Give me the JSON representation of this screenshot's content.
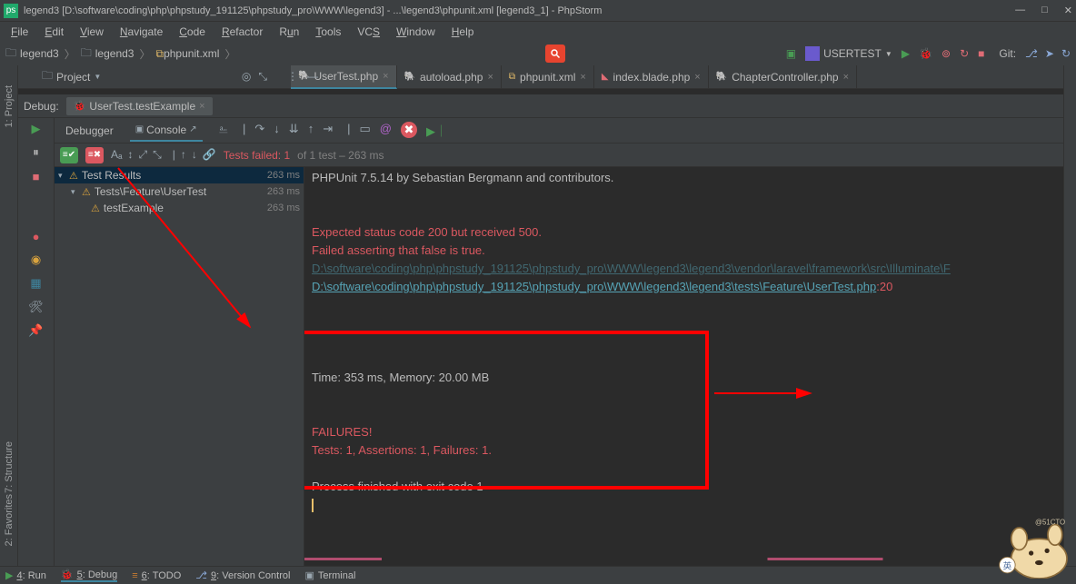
{
  "titlebar": {
    "text": "legend3 [D:\\software\\coding\\php\\phpstudy_191125\\phpstudy_pro\\WWW\\legend3] - ...\\legend3\\phpunit.xml [legend3_1] - PhpStorm"
  },
  "menu": [
    "File",
    "Edit",
    "View",
    "Navigate",
    "Code",
    "Refactor",
    "Run",
    "Tools",
    "VCS",
    "Window",
    "Help"
  ],
  "run_config": "USERTEST",
  "git_label": "Git:",
  "breadcrumb": {
    "project": "legend3",
    "folder": "legend3",
    "file": "phpunit.xml"
  },
  "project_panel": {
    "label": "Project"
  },
  "left_gutter": {
    "project": "1: Project",
    "structure": "7: Structure",
    "favorites": "2: Favorites"
  },
  "tabs": [
    {
      "label": "UserTest.php",
      "icon": "php",
      "active": true
    },
    {
      "label": "autoload.php",
      "icon": "php",
      "active": false
    },
    {
      "label": "phpunit.xml",
      "icon": "xml",
      "active": false
    },
    {
      "label": "index.blade.php",
      "icon": "blade",
      "active": false
    },
    {
      "label": "ChapterController.php",
      "icon": "php",
      "active": false
    }
  ],
  "debug_header": {
    "label": "Debug:",
    "tab": "UserTest.testExample"
  },
  "debugger_tabs": {
    "debugger": "Debugger",
    "console": "Console"
  },
  "results": {
    "failed_label": "Tests failed: 1",
    "of_label": " of 1 test – 263 ms"
  },
  "tree": [
    {
      "indent": 0,
      "name": "Test Results",
      "time": "263 ms",
      "selected": true,
      "chev": true
    },
    {
      "indent": 1,
      "name": "Tests\\Feature\\UserTest",
      "time": "263 ms",
      "selected": false,
      "chev": true
    },
    {
      "indent": 2,
      "name": "testExample",
      "time": "263 ms",
      "selected": false,
      "chev": false
    }
  ],
  "console": {
    "l1": "PHPUnit 7.5.14 by Sebastian Bergmann and contributors.",
    "l3": "Expected status code 200 but received 500.",
    "l4": "Failed asserting that false is true.",
    "l5": "D:\\software\\coding\\php\\phpstudy_191125\\phpstudy_pro\\WWW\\legend3\\legend3\\vendor\\laravel\\framework\\src\\Illuminate\\F",
    "l6a": "D:\\software\\coding\\php\\phpstudy_191125\\phpstudy_pro\\WWW\\legend3\\legend3\\tests\\Feature\\UserTest.php",
    "l6b": ":",
    "l6c": "20",
    "l8": "Time: 353 ms, Memory: 20.00 MB",
    "l10": "FAILURES!",
    "l11": "Tests: 1, Assertions: 1, Failures: 1.",
    "l13": "Process finished with exit code 1"
  },
  "statusbar": {
    "run": "4: Run",
    "debug": "5: Debug",
    "todo": "6: TODO",
    "vc": "9: Version Control",
    "term": "Terminal"
  },
  "watermark": "@51CTO"
}
